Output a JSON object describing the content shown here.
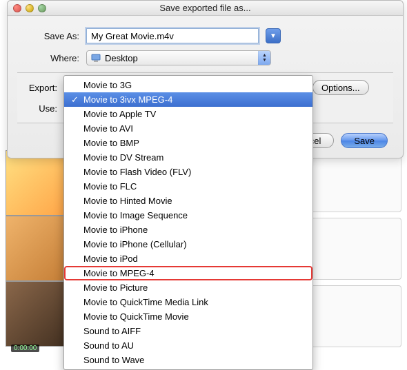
{
  "window": {
    "title": "Save exported file as..."
  },
  "form": {
    "save_as_label": "Save As:",
    "filename": "My Great Movie.m4v",
    "where_label": "Where:",
    "where_value": "Desktop",
    "export_label": "Export:",
    "export_selected": "Movie to 3ivx MPEG-4",
    "use_label": "Use:",
    "use_value": "",
    "options_label": "Options...",
    "cancel_label": "Cancel",
    "save_label": "Save"
  },
  "export_menu": {
    "items": [
      "Movie to 3G",
      "Movie to 3ivx MPEG-4",
      "Movie to Apple TV",
      "Movie to AVI",
      "Movie to BMP",
      "Movie to DV Stream",
      "Movie to Flash Video (FLV)",
      "Movie to FLC",
      "Movie to Hinted Movie",
      "Movie to Image Sequence",
      "Movie to iPhone",
      "Movie to iPhone (Cellular)",
      "Movie to iPod",
      "Movie to MPEG-4",
      "Movie to Picture",
      "Movie to QuickTime Media Link",
      "Movie to QuickTime Movie",
      "Sound to AIFF",
      "Sound to AU",
      "Sound to Wave"
    ],
    "selected_index": 1,
    "highlighted_index": 13
  },
  "background": {
    "timestamp": "0:00:00"
  }
}
